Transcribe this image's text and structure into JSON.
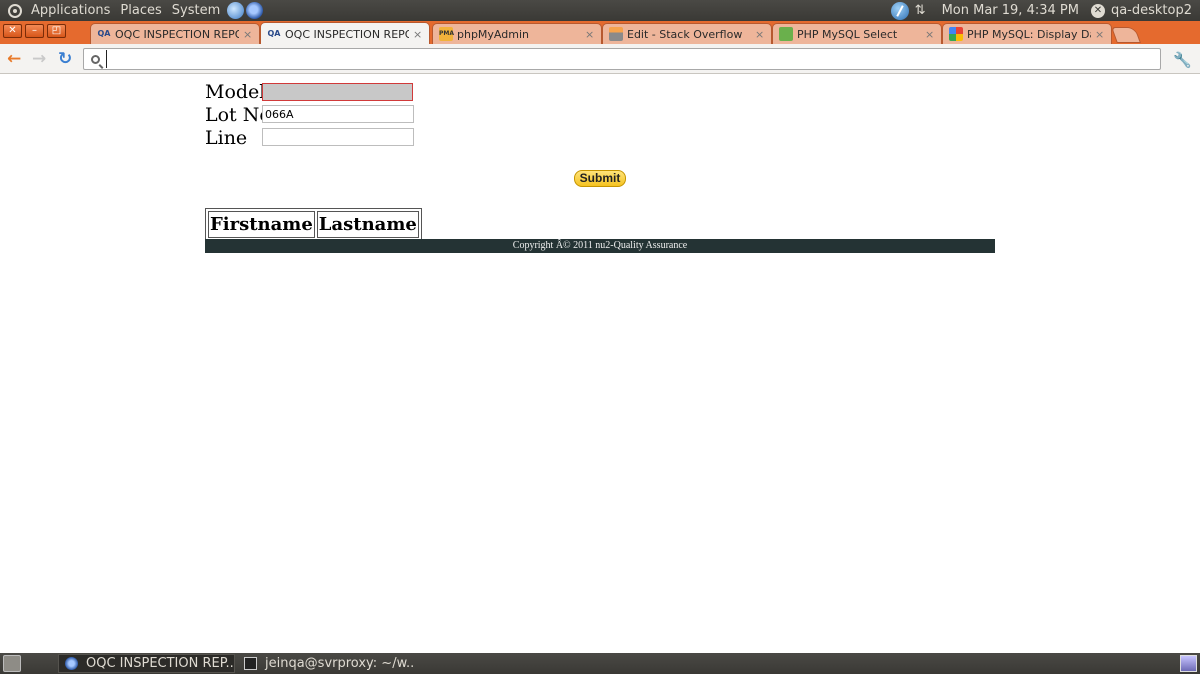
{
  "top_panel": {
    "menus": [
      "Applications",
      "Places",
      "System"
    ],
    "clock": "Mon Mar 19,  4:34 PM",
    "user": "qa-desktop2"
  },
  "tabs": [
    {
      "label": "OQC INSPECTION REPORT",
      "favicon": "QA"
    },
    {
      "label": "OQC INSPECTION REPORT",
      "favicon": "QA"
    },
    {
      "label": "phpMyAdmin",
      "favicon": "PMA"
    },
    {
      "label": "Edit - Stack Overflow",
      "favicon": ""
    },
    {
      "label": "PHP MySQL Select",
      "favicon": ""
    },
    {
      "label": "PHP MySQL: Display Data",
      "favicon": ""
    }
  ],
  "toolbar": {
    "omnibox_value": ""
  },
  "form": {
    "model_label": "Model",
    "model_value": "",
    "lot_label": "Lot No",
    "lot_value": "066A",
    "line_label": "Line",
    "line_value": "",
    "submit_label": "Submit"
  },
  "table": {
    "headers": [
      "Firstname",
      "Lastname"
    ]
  },
  "footer": {
    "text": "Copyright Â© 2011 nu2-Quality Assurance"
  },
  "taskbar": {
    "items": [
      "OQC INSPECTION REP...",
      "jeinqa@svrproxy: ~/w..."
    ]
  },
  "colors": {
    "tab_strip": "#e56a2e",
    "panel": "#3a3935",
    "footer_bar": "#243334",
    "submit": "#f5c321"
  }
}
